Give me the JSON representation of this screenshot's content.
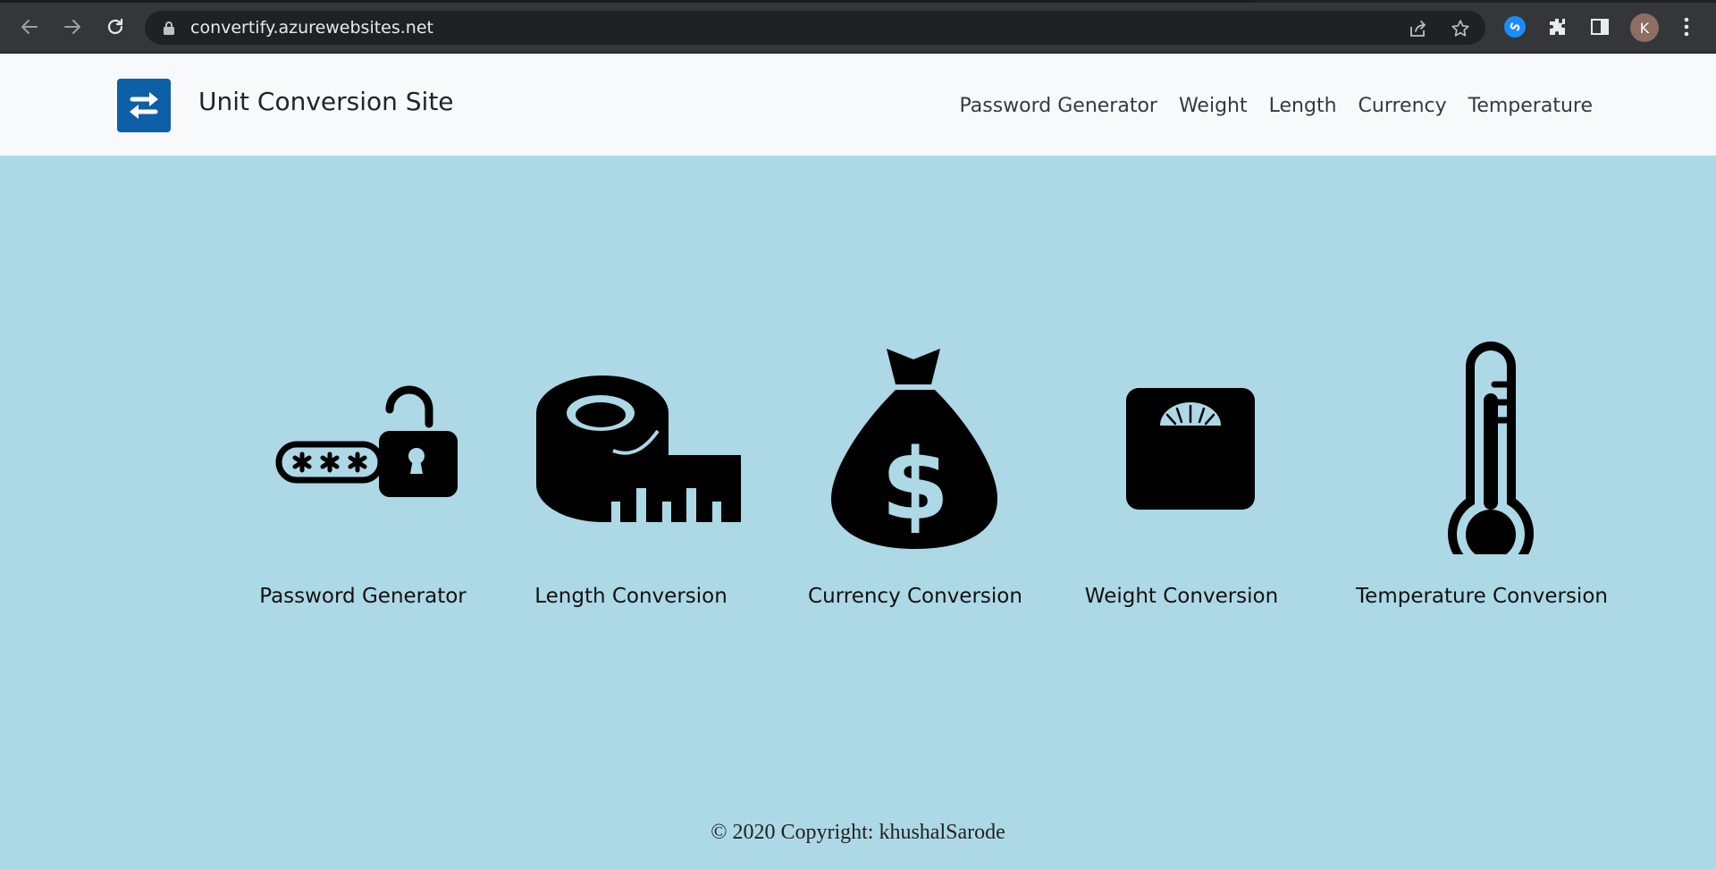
{
  "browser": {
    "url": "convertify.azurewebsites.net",
    "profile_initial": "K",
    "icons": [
      "back-icon",
      "forward-icon",
      "reload-icon",
      "lock-icon",
      "share-icon",
      "star-icon",
      "shazam-icon",
      "extensions-icon",
      "side-panel-icon",
      "menu-icon"
    ]
  },
  "header": {
    "brand_name": "Unit Conversion Site",
    "logo_color": "#0d5fa8",
    "nav": [
      {
        "label": "Password Generator"
      },
      {
        "label": "Weight"
      },
      {
        "label": "Length"
      },
      {
        "label": "Currency"
      },
      {
        "label": "Temperature"
      }
    ]
  },
  "tiles": [
    {
      "label": "Password Generator",
      "icon": "password-lock-icon"
    },
    {
      "label": "Length Conversion",
      "icon": "measuring-tape-icon"
    },
    {
      "label": "Currency Conversion",
      "icon": "money-bag-icon"
    },
    {
      "label": "Weight Conversion",
      "icon": "weighing-scale-icon"
    },
    {
      "label": "Temperature Conversion",
      "icon": "thermometer-icon"
    }
  ],
  "footer": {
    "copyright": "© 2020 Copyright: khushalSarode"
  },
  "colors": {
    "page_background": "#add8e6",
    "navbar_background": "#f8f9fa",
    "chrome_background": "#35363a"
  }
}
